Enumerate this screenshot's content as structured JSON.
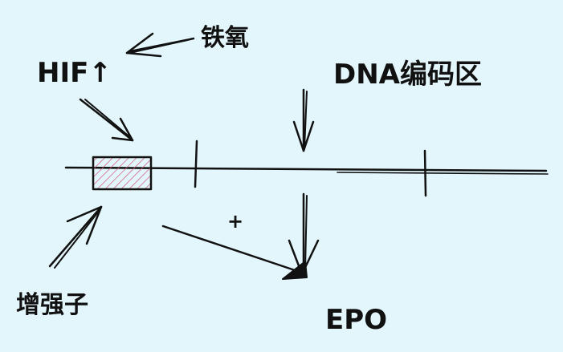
{
  "labels": {
    "iron_oxygen": "铁氧",
    "hif": "HIF↑",
    "dna_coding": "DNA编码区",
    "enhancer": "增强子",
    "plus": "+",
    "epo": "EPO"
  },
  "colors": {
    "background": "#e3f6fb",
    "ink": "#111111",
    "enhancer_hatch": "#d0557a"
  },
  "icons": [
    "arrow-icon",
    "arrowhead-icon"
  ]
}
